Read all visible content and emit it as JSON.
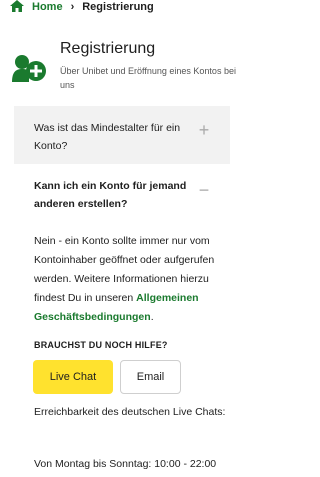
{
  "breadcrumb": {
    "home": "Home",
    "current": "Registrierung"
  },
  "hero": {
    "title": "Registrierung",
    "subtitle": "Über Unibet und Eröffnung eines Kontos bei uns"
  },
  "faq": [
    {
      "question": "Was ist das Mindestalter für ein Konto?",
      "toggle": "+"
    },
    {
      "question": "Kann ich ein Konto für jemand anderen erstellen?",
      "toggle": "−",
      "answer_text": "Nein - ein Konto sollte immer nur vom Kontoinhaber geöffnet oder aufgerufen werden. Weitere Informationen hierzu findest Du in unseren ",
      "answer_link": "Allgemeinen Geschäftsbedingungen",
      "answer_end": "."
    }
  ],
  "help": {
    "heading": "BRAUCHST DU NOCH HILFE?",
    "livechat_label": "Live Chat",
    "email_label": "Email",
    "availability": "Erreichbarkeit des deutschen Live Chats:",
    "hours": "Von Montag bis Sonntag: 10:00 - 22:00"
  },
  "colors": {
    "brand_green": "#1a7a2e",
    "livechat_yellow": "#ffe22e",
    "faq_bg": "#f2f2f2"
  },
  "icons": {
    "home": "home-icon",
    "hero": "user-plus-icon"
  }
}
